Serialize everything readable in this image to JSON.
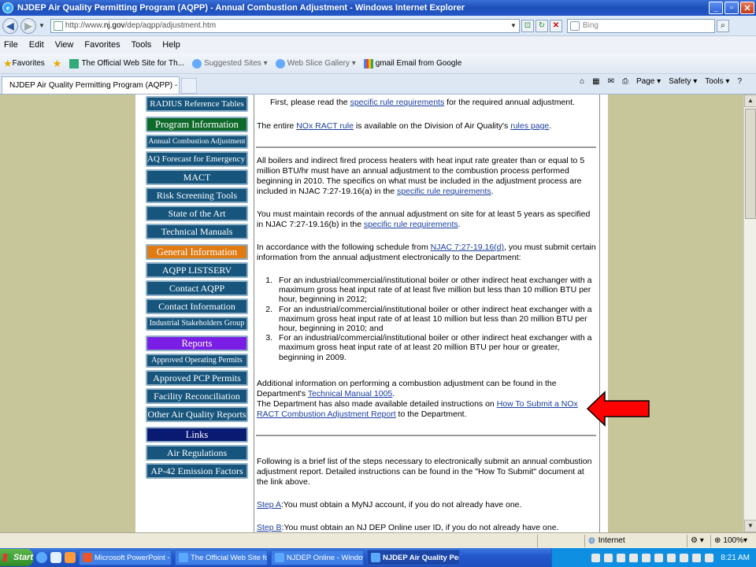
{
  "window": {
    "title": "NJDEP Air Quality Permitting Program (AQPP) - Annual Combustion Adjustment - Windows Internet Explorer"
  },
  "address": {
    "url_prefix": "http://www.",
    "url_domain": "nj.gov",
    "url_suffix": "/dep/aqpp/adjustment.htm",
    "search_placeholder": "Bing"
  },
  "menu": [
    "File",
    "Edit",
    "View",
    "Favorites",
    "Tools",
    "Help"
  ],
  "favorites": {
    "label": "Favorites",
    "items": [
      "The Official Web Site for Th...",
      "Suggested Sites ▾",
      "Web Slice Gallery ▾",
      "gmail Email from Google"
    ]
  },
  "tab": {
    "label": "NJDEP Air Quality Permitting Program (AQPP) - Annual..."
  },
  "commands": {
    "page": "Page ▾",
    "safety": "Safety ▾",
    "tools": "Tools ▾"
  },
  "sidebar": {
    "items": [
      {
        "label": "RADIUS Reference Tables",
        "style": "medium"
      },
      {
        "label": "Program Information",
        "style": "header-green"
      },
      {
        "label": "Annual Combustion Adjustment",
        "style": "small"
      },
      {
        "label": "AQ Forecast for Emergency Gen.",
        "style": "medium"
      },
      {
        "label": "MACT",
        "style": "normal"
      },
      {
        "label": "Risk Screening Tools",
        "style": "normal"
      },
      {
        "label": "State of the Art",
        "style": "normal"
      },
      {
        "label": "Technical Manuals",
        "style": "normal"
      },
      {
        "label": "General Information",
        "style": "header-orange"
      },
      {
        "label": "AQPP LISTSERV",
        "style": "normal"
      },
      {
        "label": "Contact AQPP",
        "style": "normal"
      },
      {
        "label": "Contact Information",
        "style": "normal"
      },
      {
        "label": "Industrial Stakeholders Group",
        "style": "sub"
      },
      {
        "label": "Reports",
        "style": "header-purple"
      },
      {
        "label": "Approved Operating Permits",
        "style": "sub"
      },
      {
        "label": "Approved PCP Permits",
        "style": "normal"
      },
      {
        "label": "Facility Reconciliation",
        "style": "normal"
      },
      {
        "label": "Other Air Quality Reports",
        "style": "normal"
      },
      {
        "label": "Links",
        "style": "header-navy"
      },
      {
        "label": "Air Regulations",
        "style": "normal"
      },
      {
        "label": "AP-42 Emission Factors",
        "style": "normal"
      }
    ]
  },
  "main": {
    "p1_pre": "First, please read the ",
    "p1_link": "specific rule requirements",
    "p1_post": " for the required annual adjustment.",
    "p2_pre": "The entire ",
    "p2_link": "NOx RACT rule",
    "p2_mid": " is available on the Division of Air Quality's ",
    "p2_link2": "rules page",
    "p2_post": ".",
    "p3_pre": "All boilers and indirect fired process heaters with heat input rate greater than or equal to 5 million BTU/hr must have an annual adjustment to the combustion process performed beginning in 2010.  The specifics on what must be included in the adjustment process are included in NJAC 7:27-19.16(a) in the ",
    "p3_link": "specific rule requirements",
    "p3_post": ".",
    "p4_pre": "You must maintain records of the annual adjustment on site for at least 5 years as specified in NJAC 7:27-19.16(b) in the ",
    "p4_link": "specific rule requirements",
    "p4_post": ".",
    "p5_pre": "In accordance with the following schedule from ",
    "p5_link": "NJAC 7:27-19.16(d)",
    "p5_post": ", you must submit certain information from the annual adjustment electronically to the Department:",
    "steps": [
      {
        "num": "1.",
        "text": "For an industrial/commercial/institutional boiler or other indirect heat exchanger with a maximum gross heat input rate of at least five million but less than 10 million BTU per hour, beginning in 2012;"
      },
      {
        "num": "2.",
        "text": "For an industrial/commercial/institutional boiler or other indirect heat exchanger with a maximum gross heat input rate of at least 10 million but less than 20 million BTU per hour, beginning in 2010; and"
      },
      {
        "num": "3.",
        "text": "For an industrial/commercial/institutional boiler or other indirect heat exchanger with a maximum gross heat input rate of at least 20 million BTU per hour or greater, beginning in 2009."
      }
    ],
    "p6_pre": "Additional information on performing a combustion adjustment can be found in the Department's ",
    "p6_link": "Technical Manual 1005",
    "p6_post": ".",
    "p7_pre": "The Department has also made available detailed instructions on ",
    "p7_link": "How To Submit a NOx RACT Combustion Adjustment Report",
    "p7_post": " to the Department.",
    "p8": "Following is a brief list of the steps necessary to electronically submit an annual combustion adjustment report.  Detailed instructions can be found in the \"How To Submit\" document at the link above.",
    "stepA_link": "Step A",
    "stepA_text": ":You must obtain a MyNJ account, if you do not already have one.",
    "stepB_link": "Step B",
    "stepB_text": ":You must obtain an NJ DEP Online user ID, if you do not already have one."
  },
  "status": {
    "zone": "Internet",
    "zoom": "100%"
  },
  "taskbar": {
    "start": "Start",
    "tasks": [
      {
        "label": "Microsoft PowerPoint - [...",
        "active": false
      },
      {
        "label": "The Official Web Site for ...",
        "active": false
      },
      {
        "label": "NJDEP Online - Windows ...",
        "active": false
      },
      {
        "label": "NJDEP Air Quality Per...",
        "active": true
      }
    ],
    "clock": "8:21 AM"
  },
  "colors": {
    "nav_blue": "#17557c",
    "program_green": "#0e6a2a",
    "general_orange": "#e07a12",
    "reports_purple": "#7a1ee6",
    "links_navy": "#0a1a72",
    "arrow_red": "#ff0000"
  }
}
